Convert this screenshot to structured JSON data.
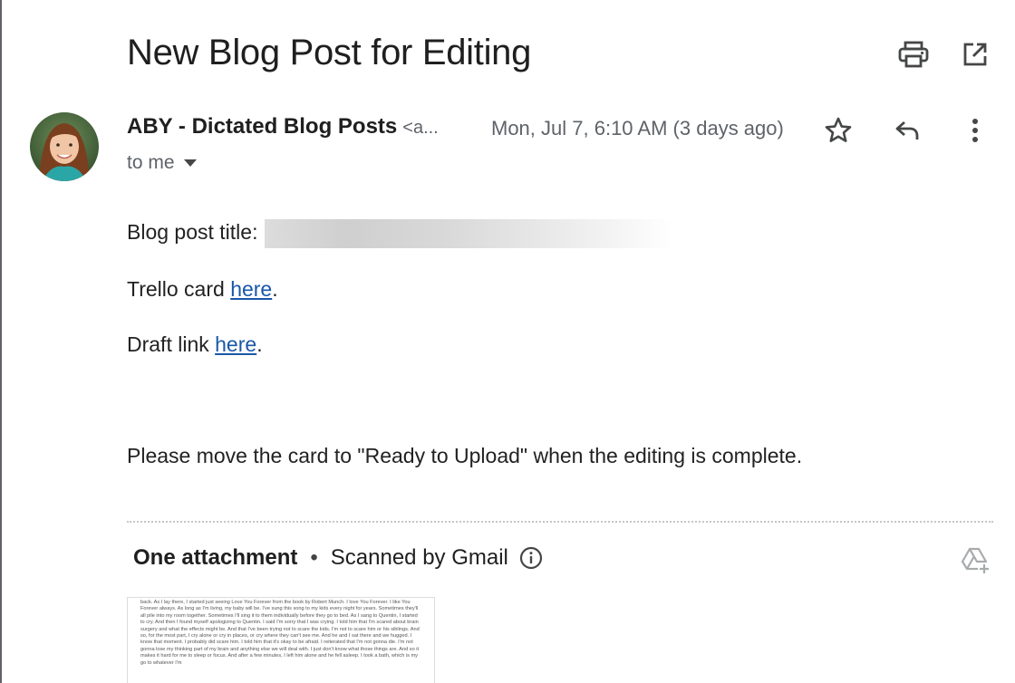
{
  "email": {
    "subject": "New Blog Post for Editing",
    "sender_name": "ABY - Dictated Blog Posts",
    "sender_email": "<a...",
    "date": "Mon, Jul 7, 6:10 AM (3 days ago)",
    "recipient": "to me"
  },
  "body": {
    "title_label": "Blog post title:",
    "trello_prefix": "Trello card",
    "trello_link": "here",
    "draft_prefix": "Draft link",
    "draft_link": "here",
    "period": ".",
    "instruction": "Please move the card to \"Ready to Upload\" when the editing is complete."
  },
  "attachments": {
    "title": "One attachment",
    "bullet": "•",
    "scanned": "Scanned by Gmail",
    "preview_text": "back. As I lay there, I started just seeing Love You Forever from the book by Robert Munch. I love You Forever. I like You Forever always. As long as I'm living, my baby will be. I've sung this song to my kids every night for years. Sometimes they'll all pile into my room together. Sometimes I'll sing it to them individually before they go to bed. As I sang to Quentin, I started to cry. And then I found myself apologizing to Quentin. I said I'm sorry that I was crying. I told him that I'm scared about brain surgery and what the effects might be. And that I've been trying not to scare the kids. I'm not to scare him or his siblings. And so, for the most part, I cry alone or cry in places, or cry where they can't see me. And he and I sat there and we hugged. I know that moment. I probably did scare him. I told him that it's okay to be afraid. I reiterated that I'm not gonna die. I'm not gonna lose my thinking part of my brain and anything else we will deal with. I just don't know what those things are. And so it makes it hard for me to sleep or focus. And after a few minutes, I left him alone and he fell asleep. I took a bath, which is my go to whatever I'm"
  },
  "icons": {
    "print": "print-icon",
    "open_new_window": "open-in-new-window-icon",
    "star": "star-icon",
    "reply": "reply-icon",
    "more": "more-vertical-icon",
    "dropdown": "caret-down-icon",
    "info": "info-icon",
    "drive": "add-to-drive-icon"
  },
  "colors": {
    "link": "#1a57a8",
    "secondary_text": "#5f6368",
    "primary_text": "#1f1f1f"
  }
}
